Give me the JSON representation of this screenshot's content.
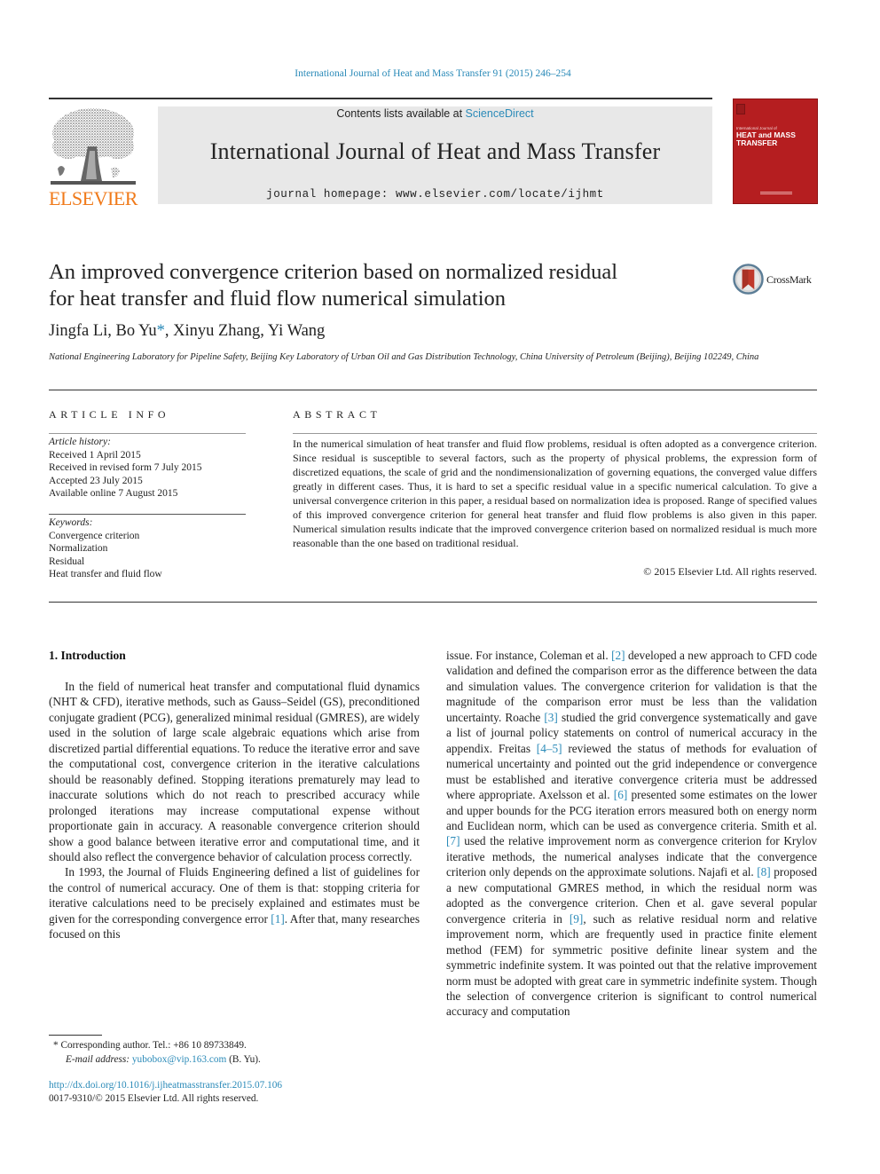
{
  "running_head": "International Journal of Heat and Mass Transfer 91 (2015) 246–254",
  "banner": {
    "contents_prefix": "Contents lists available at ",
    "contents_link": "ScienceDirect",
    "journal_title": "International Journal of Heat and Mass Transfer",
    "homepage_prefix": "journal homepage: ",
    "homepage_url": "www.elsevier.com/locate/ijhmt"
  },
  "publisher_logo": {
    "wordmark": "ELSEVIER",
    "icon": "elsevier-tree-icon",
    "color": "#f07a1a"
  },
  "journal_cover": {
    "small_line": "International Journal of",
    "title_line1": "HEAT and MASS",
    "title_line2": "TRANSFER",
    "color": "#b51e20"
  },
  "crossmark": {
    "label": "CrossMark",
    "icon": "crossmark-icon"
  },
  "article": {
    "title_line1": "An improved convergence criterion based on normalized residual",
    "title_line2": "for heat transfer and fluid flow numerical simulation",
    "authors": [
      {
        "name": "Jingfa Li",
        "sep": ", "
      },
      {
        "name": "Bo Yu",
        "mark": "*",
        "sep": ", "
      },
      {
        "name": "Xinyu Zhang",
        "sep": ", "
      },
      {
        "name": "Yi Wang",
        "sep": ""
      }
    ],
    "affiliation": "National Engineering Laboratory for Pipeline Safety, Beijing Key Laboratory of Urban Oil and Gas Distribution Technology, China University of Petroleum (Beijing), Beijing 102249, China"
  },
  "article_info": {
    "heading": "ARTICLE INFO",
    "history_label": "Article history:",
    "history": [
      "Received 1 April 2015",
      "Received in revised form 7 July 2015",
      "Accepted 23 July 2015",
      "Available online 7 August 2015"
    ],
    "keywords_label": "Keywords:",
    "keywords": [
      "Convergence criterion",
      "Normalization",
      "Residual",
      "Heat transfer and fluid flow"
    ]
  },
  "abstract": {
    "heading": "ABSTRACT",
    "text": "In the numerical simulation of heat transfer and fluid flow problems, residual is often adopted as a convergence criterion. Since residual is susceptible to several factors, such as the property of physical problems, the expression form of discretized equations, the scale of grid and the nondimensionalization of governing equations, the converged value differs greatly in different cases. Thus, it is hard to set a specific residual value in a specific numerical calculation. To give a universal convergence criterion in this paper, a residual based on normalization idea is proposed. Range of specified values of this improved convergence criterion for general heat transfer and fluid flow problems is also given in this paper. Numerical simulation results indicate that the improved convergence criterion based on normalized residual is much more reasonable than the one based on traditional residual.",
    "copyright": "© 2015 Elsevier Ltd. All rights reserved."
  },
  "body": {
    "section_heading": "1. Introduction",
    "left_paragraphs": [
      [
        {
          "t": "In the field of numerical heat transfer and computational fluid dynamics (NHT & CFD), iterative methods, such as Gauss–Seidel (GS), preconditioned conjugate gradient (PCG), generalized minimal residual (GMRES), are widely used in the solution of large scale algebraic equations which arise from discretized partial differential equations. To reduce the iterative error and save the computational cost, convergence criterion in the iterative calculations should be reasonably defined. Stopping iterations prematurely may lead to inaccurate solutions which do not reach to prescribed accuracy while prolonged iterations may increase computational expense without proportionate gain in accuracy. A reasonable convergence criterion should show a good balance between iterative error and computational time, and it should also reflect the convergence behavior of calculation process correctly."
        }
      ],
      [
        {
          "t": "In 1993, the Journal of Fluids Engineering defined a list of guidelines for the control of numerical accuracy. One of them is that: stopping criteria for iterative calculations need to be precisely explained and estimates must be given for the corresponding convergence error "
        },
        {
          "ref": "[1]"
        },
        {
          "t": ". After that, many researches focused on this"
        }
      ]
    ],
    "right_paragraphs": [
      [
        {
          "t": "issue. For instance, Coleman et al. "
        },
        {
          "ref": "[2]"
        },
        {
          "t": " developed a new approach to CFD code validation and defined the comparison error as the difference between the data and simulation values. The convergence criterion for validation is that the magnitude of the comparison error must be less than the validation uncertainty. Roache "
        },
        {
          "ref": "[3]"
        },
        {
          "t": " studied the grid convergence systematically and gave a list of journal policy statements on control of numerical accuracy in the appendix. Freitas "
        },
        {
          "ref": "[4–5]"
        },
        {
          "t": " reviewed the status of methods for evaluation of numerical uncertainty and pointed out the grid independence or convergence must be established and iterative convergence criteria must be addressed where appropriate. Axelsson et al. "
        },
        {
          "ref": "[6]"
        },
        {
          "t": " presented some estimates on the lower and upper bounds for the PCG iteration errors measured both on energy norm and Euclidean norm, which can be used as convergence criteria. Smith et al. "
        },
        {
          "ref": "[7]"
        },
        {
          "t": " used the relative improvement norm as convergence criterion for Krylov iterative methods, the numerical analyses indicate that the convergence criterion only depends on the approximate solutions. Najafi et al. "
        },
        {
          "ref": "[8]"
        },
        {
          "t": " proposed a new computational GMRES method, in which the residual norm was adopted as the convergence criterion. Chen et al. gave several popular convergence criteria in "
        },
        {
          "ref": "[9]"
        },
        {
          "t": ", such as relative residual norm and relative improvement norm, which are frequently used in practice finite element method (FEM) for symmetric positive definite linear system and the symmetric indefinite system. It was pointed out that the relative improvement norm must be adopted with great care in symmetric indefinite system. Though the selection of convergence criterion is significant to control numerical accuracy and computation"
        }
      ]
    ]
  },
  "footnote": {
    "mark": "*",
    "corresponding": "Corresponding author. Tel.: +86 10 89733849.",
    "email_label": "E-mail address:",
    "email": "yubobox@vip.163.com",
    "email_suffix": " (B. Yu)."
  },
  "doi": {
    "url": "http://dx.doi.org/10.1016/j.ijheatmasstransfer.2015.07.106",
    "issn_line": "0017-9310/© 2015 Elsevier Ltd. All rights reserved."
  }
}
